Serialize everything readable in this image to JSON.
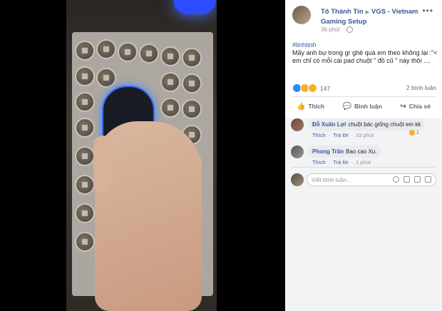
{
  "post": {
    "author": "Tô Thành Tín",
    "group": "VGS - Vietnam Gaming Setup",
    "time": "36 phút",
    "hashtag": "#linhtinh",
    "text_line1": "Mấy anh bự trong gr ghê quá em theo không lại :\"<",
    "text_line2": "em chỉ có mỗi cái pad chuột \" đồ cũ \" này thôi ....",
    "reaction_count": "147",
    "comment_count": "2 bình luận"
  },
  "actions": {
    "like": "Thích",
    "comment": "Bình luận",
    "share": "Chia sẻ"
  },
  "comments": [
    {
      "name": "Đỗ Xuân Lợi",
      "text": "chuột bác giống chuột em kk",
      "like": "Thích",
      "reply": "Trả lời",
      "time": "33 phút",
      "reactions": "1"
    },
    {
      "name": "Phong Trần",
      "text": "Bao cao Xu.",
      "like": "Thích",
      "reply": "Trả lời",
      "time": "1 phút"
    }
  ],
  "composer": {
    "placeholder": "Viết bình luận..."
  },
  "icons": {
    "more": "more-icon",
    "globe": "globe-icon",
    "like": "thumb-up-icon",
    "comment": "speech-bubble-icon",
    "share": "share-arrow-icon",
    "emoji": "emoji-icon",
    "camera": "camera-icon",
    "gif": "gif-icon",
    "sticker": "sticker-icon"
  },
  "colors": {
    "link": "#365899",
    "like_reaction": "#2d88ff",
    "haha_reaction": "#f7b125"
  }
}
